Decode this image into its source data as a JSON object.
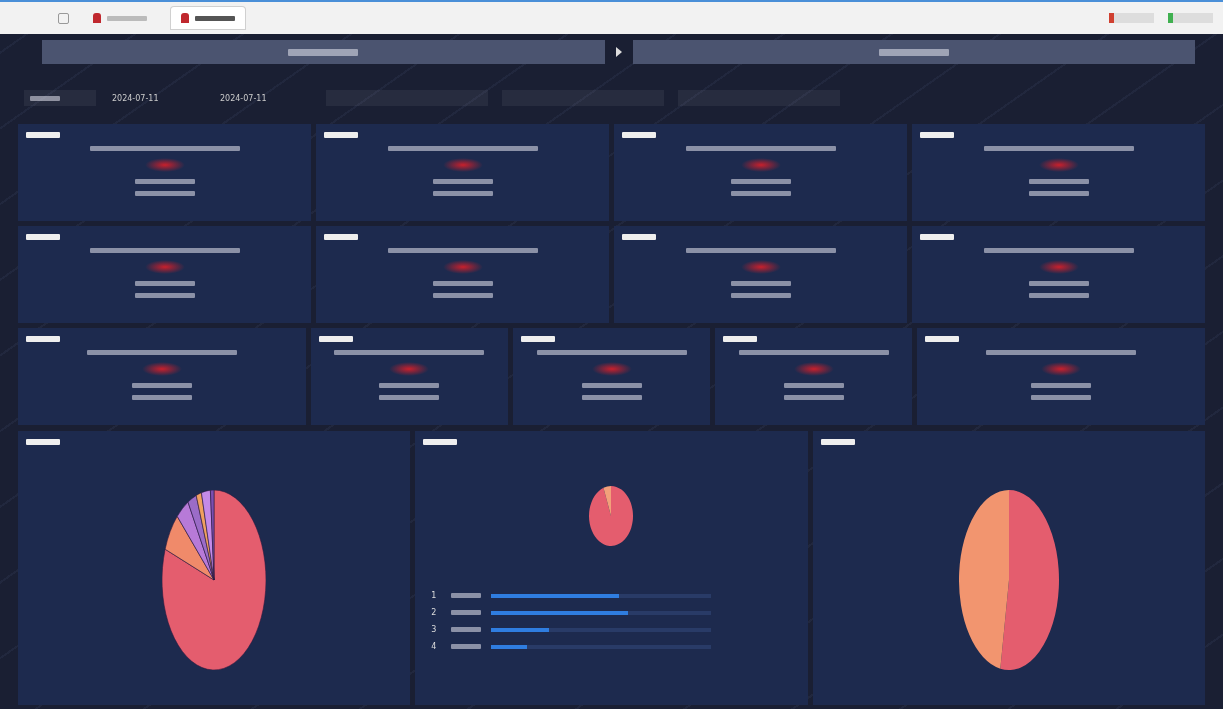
{
  "browser_tabs": [
    {
      "selected": false
    },
    {
      "selected": true
    }
  ],
  "filters": {
    "start_date": "2024-07-11",
    "end_date": "2024-07-11"
  },
  "kpi_rows": [
    {
      "cards": [
        {
          "kind": "kpi"
        },
        {
          "kind": "kpi"
        },
        {
          "kind": "kpi"
        },
        {
          "kind": "kpi"
        }
      ]
    },
    {
      "cards": [
        {
          "kind": "kpi"
        },
        {
          "kind": "kpi"
        },
        {
          "kind": "kpi"
        },
        {
          "kind": "kpi"
        }
      ]
    },
    {
      "cards": [
        {
          "kind": "kpi"
        },
        {
          "kind": "kpi-narrow"
        },
        {
          "kind": "kpi-narrow"
        },
        {
          "kind": "kpi-narrow"
        },
        {
          "kind": "kpi"
        }
      ]
    }
  ],
  "bottom_panels": [
    {
      "kind": "multi-pie"
    },
    {
      "kind": "pie-ranking"
    },
    {
      "kind": "half-pie"
    }
  ],
  "ranking_rows": [
    {
      "rank": "1",
      "level": 0.58
    },
    {
      "rank": "2",
      "level": 0.62
    },
    {
      "rank": "3",
      "level": 0.26
    },
    {
      "rank": "4",
      "level": 0.16
    }
  ]
}
